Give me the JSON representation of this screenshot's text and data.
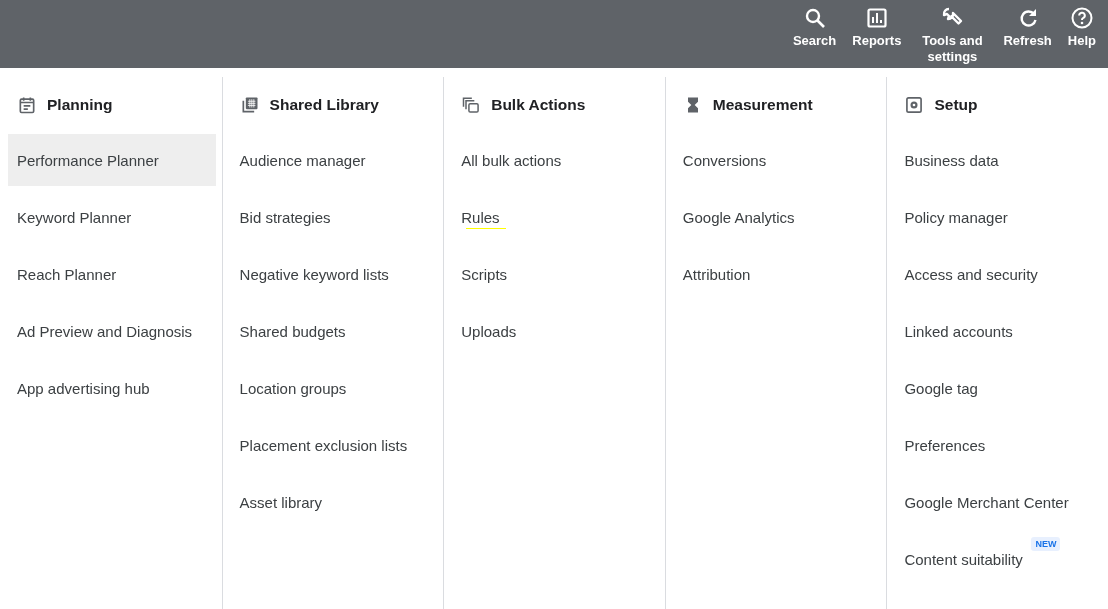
{
  "toolbar": [
    {
      "label": "Search"
    },
    {
      "label": "Reports"
    },
    {
      "label": "Tools and settings"
    },
    {
      "label": "Refresh"
    },
    {
      "label": "Help"
    }
  ],
  "columns": [
    {
      "title": "Planning",
      "items": [
        {
          "label": "Performance Planner",
          "selected": true,
          "underlined": false
        },
        {
          "label": "Keyword Planner",
          "selected": false,
          "underlined": false
        },
        {
          "label": "Reach Planner",
          "selected": false,
          "underlined": false
        },
        {
          "label": "Ad Preview and Diagnosis",
          "selected": false,
          "underlined": false
        },
        {
          "label": "App advertising hub",
          "selected": false,
          "underlined": false
        }
      ]
    },
    {
      "title": "Shared Library",
      "items": [
        {
          "label": "Audience manager",
          "selected": false,
          "underlined": false
        },
        {
          "label": "Bid strategies",
          "selected": false,
          "underlined": false
        },
        {
          "label": "Negative keyword lists",
          "selected": false,
          "underlined": false
        },
        {
          "label": "Shared budgets",
          "selected": false,
          "underlined": false
        },
        {
          "label": "Location groups",
          "selected": false,
          "underlined": false
        },
        {
          "label": "Placement exclusion lists",
          "selected": false,
          "underlined": false
        },
        {
          "label": "Asset library",
          "selected": false,
          "underlined": false
        }
      ]
    },
    {
      "title": "Bulk Actions",
      "items": [
        {
          "label": "All bulk actions",
          "selected": false,
          "underlined": false
        },
        {
          "label": "Rules",
          "selected": false,
          "underlined": true
        },
        {
          "label": "Scripts",
          "selected": false,
          "underlined": false
        },
        {
          "label": "Uploads",
          "selected": false,
          "underlined": false
        }
      ]
    },
    {
      "title": "Measurement",
      "items": [
        {
          "label": "Conversions",
          "selected": false,
          "underlined": false
        },
        {
          "label": "Google Analytics",
          "selected": false,
          "underlined": false
        },
        {
          "label": "Attribution",
          "selected": false,
          "underlined": false
        }
      ]
    },
    {
      "title": "Setup",
      "items": [
        {
          "label": "Business data",
          "selected": false,
          "underlined": false
        },
        {
          "label": "Policy manager",
          "selected": false,
          "underlined": false
        },
        {
          "label": "Access and security",
          "selected": false,
          "underlined": false
        },
        {
          "label": "Linked accounts",
          "selected": false,
          "underlined": false
        },
        {
          "label": "Google tag",
          "selected": false,
          "underlined": false
        },
        {
          "label": "Preferences",
          "selected": false,
          "underlined": false
        },
        {
          "label": "Google Merchant Center",
          "selected": false,
          "underlined": false
        },
        {
          "label": "Content suitability",
          "selected": false,
          "underlined": false,
          "badge": "NEW"
        }
      ]
    }
  ]
}
